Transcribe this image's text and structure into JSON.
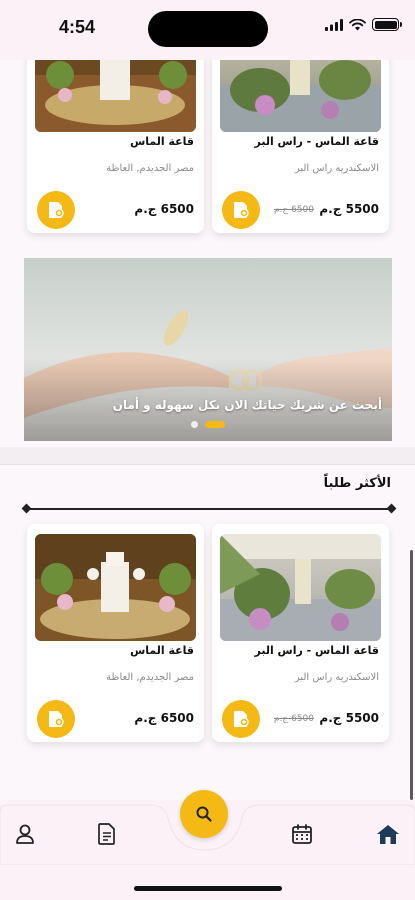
{
  "status_bar": {
    "time": "4:54"
  },
  "top_cards": [
    {
      "title": "قاعة الماس - راس البر",
      "location": "الاسكندريه راس البر",
      "price": "5500 ج.م",
      "old_price": "6500 ج.م"
    },
    {
      "title": "قاعة الماس",
      "location": "مصر الجديدم, العاظة",
      "price": "6500 ج.م",
      "old_price": ""
    }
  ],
  "banner": {
    "text": "أبحث عن شريك حياتك الان بكل سهوله و أمان"
  },
  "section": {
    "title": "الأكثر طلباً"
  },
  "popular_cards": [
    {
      "title": "قاعة الماس - راس البر",
      "location": "الاسكندريه راس البر",
      "price": "5500 ج.م",
      "old_price": "6500 ج.م"
    },
    {
      "title": "قاعة الماس",
      "location": "مصر الجديدم, العاظة",
      "price": "6500 ج.م",
      "old_price": ""
    }
  ],
  "icons": {
    "profile": "person-icon",
    "documents": "document-icon",
    "search": "search-icon",
    "calendar": "calendar-icon",
    "home": "home-icon",
    "book": "booking-icon"
  },
  "colors": {
    "accent": "#f5b915",
    "nav_active": "#1e3a5a",
    "background": "#fbf7fa"
  }
}
